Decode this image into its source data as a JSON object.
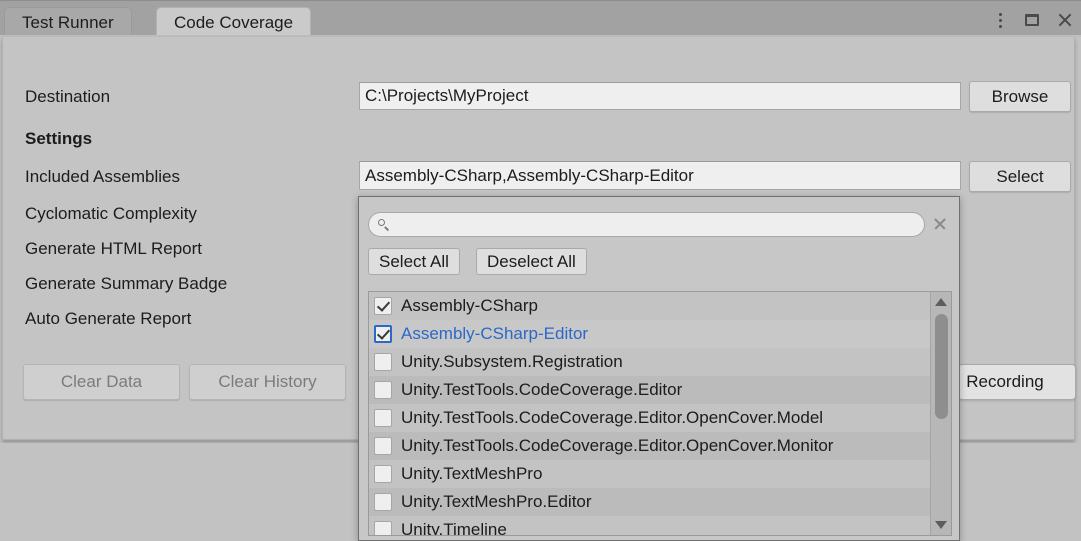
{
  "window": {
    "tabs": [
      {
        "label": "Test Runner",
        "active": false
      },
      {
        "label": "Code Coverage",
        "active": true
      }
    ],
    "controls": {
      "menu": "kebab-menu-icon",
      "maximize": "maximize-icon",
      "close": "close-icon"
    }
  },
  "main": {
    "destination": {
      "label": "Destination",
      "value": "C:\\Projects\\MyProject",
      "browse_label": "Browse"
    },
    "settings_header": "Settings",
    "included_assemblies": {
      "label": "Included Assemblies",
      "value": "Assembly-CSharp,Assembly-CSharp-Editor",
      "select_label": "Select"
    },
    "options": [
      "Cyclomatic Complexity",
      "Generate HTML Report",
      "Generate Summary Badge",
      "Auto Generate Report"
    ],
    "buttons": {
      "clear_data": "Clear Data",
      "clear_history": "Clear History",
      "recording": "Recording"
    }
  },
  "popup": {
    "search": {
      "value": "",
      "placeholder": "",
      "icon": "search-icon",
      "clear_icon": "clear-icon"
    },
    "select_all_label": "Select All",
    "deselect_all_label": "Deselect All",
    "items": [
      {
        "label": "Assembly-CSharp",
        "checked": true,
        "selected": false
      },
      {
        "label": "Assembly-CSharp-Editor",
        "checked": true,
        "selected": true
      },
      {
        "label": "Unity.Subsystem.Registration",
        "checked": false,
        "selected": false
      },
      {
        "label": "Unity.TestTools.CodeCoverage.Editor",
        "checked": false,
        "selected": false
      },
      {
        "label": "Unity.TestTools.CodeCoverage.Editor.OpenCover.Model",
        "checked": false,
        "selected": false
      },
      {
        "label": "Unity.TestTools.CodeCoverage.Editor.OpenCover.Monitor",
        "checked": false,
        "selected": false
      },
      {
        "label": "Unity.TextMeshPro",
        "checked": false,
        "selected": false
      },
      {
        "label": "Unity.TextMeshPro.Editor",
        "checked": false,
        "selected": false
      },
      {
        "label": "Unity.Timeline",
        "checked": false,
        "selected": false
      }
    ]
  },
  "colors": {
    "accent": "#2c68c8",
    "window_bg": "#c4c4c4",
    "tab_active": "#cacaca",
    "field_bg": "#efefef"
  }
}
